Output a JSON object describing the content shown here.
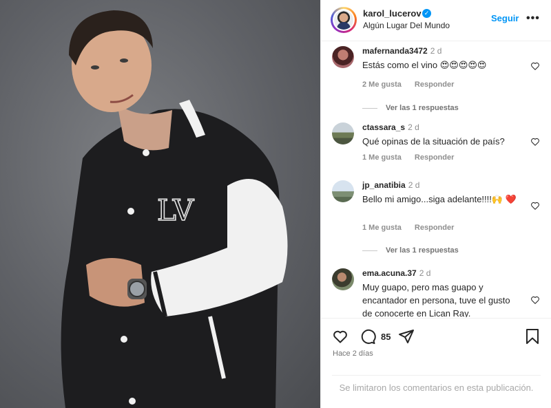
{
  "header": {
    "username": "karol_lucerov",
    "location": "Algún Lugar Del Mundo",
    "follow_label": "Seguir",
    "more_label": "•••"
  },
  "comments": [
    {
      "user": "mafernanda3472",
      "time": "2 d",
      "text": "Estás como el vino 😍😍😍😍😍",
      "likes": "2 Me gusta",
      "reply": "Responder",
      "replies": "Ver las 1 respuestas"
    },
    {
      "user": "ctassara_s",
      "time": "2 d",
      "text": "Qué opinas de la situación de país?",
      "likes": "1 Me gusta",
      "reply": "Responder"
    },
    {
      "user": "jp_anatibia",
      "time": "2 d",
      "text": "Bello mi amigo...siga adelante!!!!🙌 ❤️",
      "likes": "1 Me gusta",
      "reply": "Responder",
      "replies": "Ver las 1 respuestas"
    },
    {
      "user": "ema.acuna.37",
      "time": "2 d",
      "text": "Muy guapo, pero mas guapo y encantador en persona, tuve el gusto de conocerte en Lican Ray."
    }
  ],
  "actions": {
    "comment_count": "85",
    "time_ago": "Hace 2 días",
    "icons": [
      "heart-icon",
      "comment-icon",
      "share-icon",
      "bookmark-icon"
    ]
  },
  "limited_comments": "Se limitaron los comentarios en esta publicación.",
  "photo": {
    "jacket_monogram": "LV"
  },
  "colors": {
    "accent": "#0095f6",
    "muted": "#8e8e8e",
    "heart_red": "#ed4956"
  }
}
